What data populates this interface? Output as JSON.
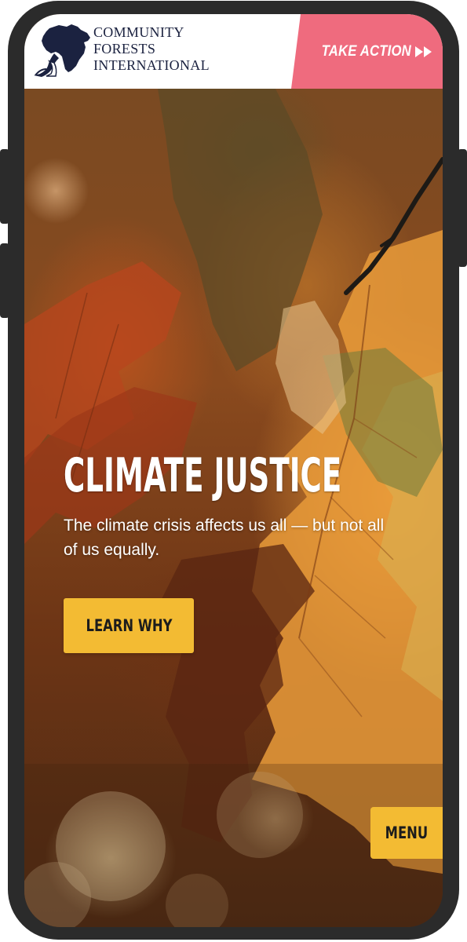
{
  "header": {
    "logo": {
      "icon": "africa-map-tree-logo-icon",
      "lines": [
        "COMMUNITY",
        "FORESTS",
        "INTERNATIONAL"
      ]
    },
    "take_action": {
      "label": "TAKE ACTION",
      "icon": "double-chevron-right-icon",
      "color": "#ef6b7e"
    }
  },
  "hero": {
    "title": "CLIMATE JUSTICE",
    "subtitle": "The climate crisis affects us all — but not all of us equally.",
    "cta_label": "LEARN WHY",
    "cta_color": "#f3bb33"
  },
  "menu": {
    "label": "MENU",
    "color": "#f3bb33"
  },
  "colors": {
    "device_frame": "#2b2b2b",
    "logo_text": "#1b2240"
  }
}
